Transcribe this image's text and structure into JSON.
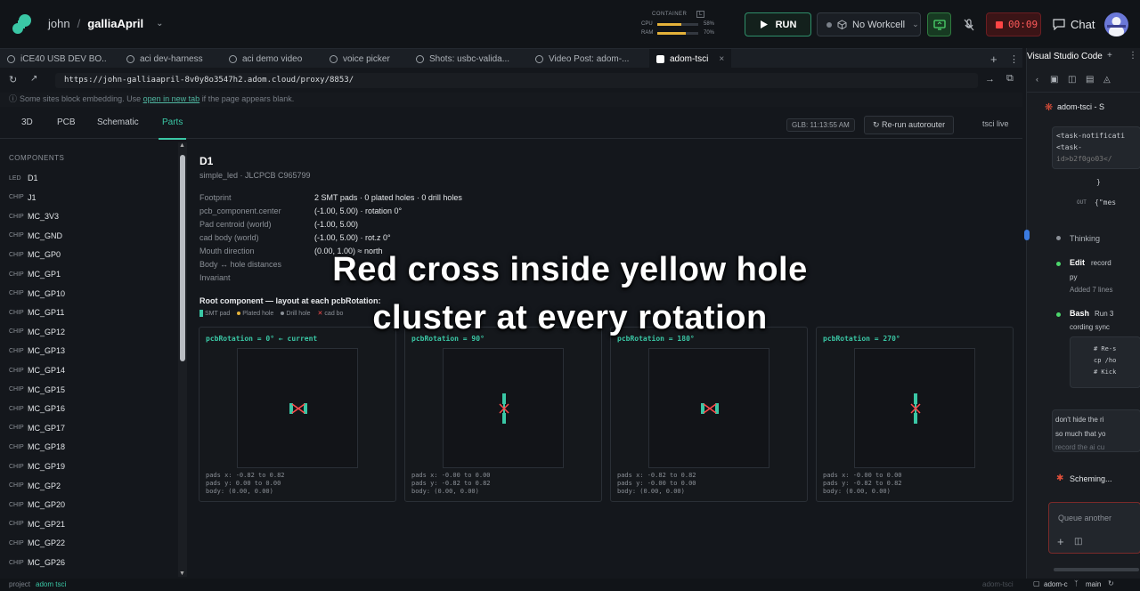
{
  "topbar": {
    "user": "john",
    "separator": "/",
    "workspace": "galliaApril",
    "container_label": "CONTAINER",
    "container_tag": "L",
    "cpu_label": "CPU",
    "cpu_pct": "58%",
    "cpu_fraction": 0.58,
    "ram_label": "RAM",
    "ram_pct": "70%",
    "ram_fraction": 0.7,
    "run_label": "RUN",
    "workcell_label": "No Workcell",
    "timer": "00:09",
    "chat_label": "Chat"
  },
  "browser_tabs": [
    {
      "label": "iCE40 USB DEV BO..."
    },
    {
      "label": "aci dev-harness"
    },
    {
      "label": "aci demo video"
    },
    {
      "label": "voice picker"
    },
    {
      "label": "Shots: usbc-valida..."
    },
    {
      "label": "Video Post: adom-..."
    },
    {
      "label": "adom-tsci",
      "active": true
    }
  ],
  "url": "https://john-galliaapril-8v0y8o3547h2.adom.cloud/proxy/8853/",
  "notice": {
    "before": "Some sites block embedding. Use",
    "link": "open in new tab",
    "after": "if the page appears blank."
  },
  "app_tabs": [
    "3D",
    "PCB",
    "Schematic",
    "Parts"
  ],
  "app_active_tab": "Parts",
  "glb_label": "GLB: 11:13:55 AM",
  "rerun_label": "Re-run autorouter",
  "tsci_live": "tsci live",
  "sidebar": {
    "header": "COMPONENTS",
    "items": [
      {
        "kind": "LED",
        "name": "D1"
      },
      {
        "kind": "CHIP",
        "name": "J1"
      },
      {
        "kind": "CHIP",
        "name": "MC_3V3"
      },
      {
        "kind": "CHIP",
        "name": "MC_GND"
      },
      {
        "kind": "CHIP",
        "name": "MC_GP0"
      },
      {
        "kind": "CHIP",
        "name": "MC_GP1"
      },
      {
        "kind": "CHIP",
        "name": "MC_GP10"
      },
      {
        "kind": "CHIP",
        "name": "MC_GP11"
      },
      {
        "kind": "CHIP",
        "name": "MC_GP12"
      },
      {
        "kind": "CHIP",
        "name": "MC_GP13"
      },
      {
        "kind": "CHIP",
        "name": "MC_GP14"
      },
      {
        "kind": "CHIP",
        "name": "MC_GP15"
      },
      {
        "kind": "CHIP",
        "name": "MC_GP16"
      },
      {
        "kind": "CHIP",
        "name": "MC_GP17"
      },
      {
        "kind": "CHIP",
        "name": "MC_GP18"
      },
      {
        "kind": "CHIP",
        "name": "MC_GP19"
      },
      {
        "kind": "CHIP",
        "name": "MC_GP2"
      },
      {
        "kind": "CHIP",
        "name": "MC_GP20"
      },
      {
        "kind": "CHIP",
        "name": "MC_GP21"
      },
      {
        "kind": "CHIP",
        "name": "MC_GP22"
      },
      {
        "kind": "CHIP",
        "name": "MC_GP26"
      }
    ]
  },
  "part": {
    "title": "D1",
    "subtitle": "simple_led · JLCPCB C965799",
    "props": [
      {
        "key": "Footprint",
        "value": "2 SMT pads · 0 plated holes · 0 drill holes"
      },
      {
        "key": "pcb_component.center",
        "value": "(-1.00, 5.00) · rotation 0°"
      },
      {
        "key": "Pad centroid (world)",
        "value": "(-1.00, 5.00)"
      },
      {
        "key": "cad body (world)",
        "value": "(-1.00, 5.00) · rot.z 0°"
      },
      {
        "key": "Mouth direction",
        "value": "(0.00, 1.00) ≈ north"
      },
      {
        "key": "Body ↔ hole distances",
        "value": ""
      },
      {
        "key": "Invariant",
        "value": ""
      }
    ],
    "section_title": "Root component — layout at each pcbRotation:",
    "legend": [
      "SMT pad",
      "Plated hole",
      "Drill hole",
      "cad bo"
    ]
  },
  "panels": [
    {
      "title": "pcbRotation = 0° ← current",
      "orientation": "h",
      "pads_x": "pads x: -0.82 to 0.82",
      "pads_y": "pads y: 0.00 to 0.00",
      "body": "body: (0.00, 0.00)"
    },
    {
      "title": "pcbRotation = 90°",
      "orientation": "v",
      "pads_x": "pads x: -0.00 to 0.00",
      "pads_y": "pads y: -0.82 to 0.82",
      "body": "body: (0.00, 0.00)"
    },
    {
      "title": "pcbRotation = 180°",
      "orientation": "h",
      "pads_x": "pads x: -0.82 to 0.82",
      "pads_y": "pads y: -0.00 to 0.00",
      "body": "body: (0.00, 0.00)"
    },
    {
      "title": "pcbRotation = 270°",
      "orientation": "v",
      "pads_x": "pads x: -0.00 to 0.00",
      "pads_y": "pads y: -0.82 to 0.82",
      "body": "body: (0.00, 0.00)"
    }
  ],
  "caption": {
    "line1": "Red cross inside yellow hole",
    "line2": "cluster at every rotation"
  },
  "right_panel": {
    "tab": "Visual Studio Code",
    "session": "adom-tsci - S",
    "msg1": "<task-notificati",
    "msg1b": "<task-",
    "msg1c": "id>b2f0go03</",
    "brace": "}",
    "out_label": "OUT",
    "out_val": "{\"mes",
    "thinking": "Thinking",
    "edit_label": "Edit",
    "edit_file": "record",
    "edit_ext": "py",
    "edit_added": "Added 7 lines",
    "bash_label": "Bash",
    "bash_desc": "Run 3",
    "bash_desc2": "cording sync",
    "code1": "# Re-s",
    "code2": "cp /ho",
    "code3": "# Kick",
    "user_msg1": "don't hide the ri",
    "user_msg2": "so much that yo",
    "user_msg3": "record the ai cu",
    "status": "Scheming...",
    "queue_placeholder": "Queue another"
  },
  "statusbar": {
    "project_label": "project",
    "project": "adom tsci",
    "right_label": "adom-tsci",
    "workspace": "adom-c",
    "branch": "main"
  }
}
